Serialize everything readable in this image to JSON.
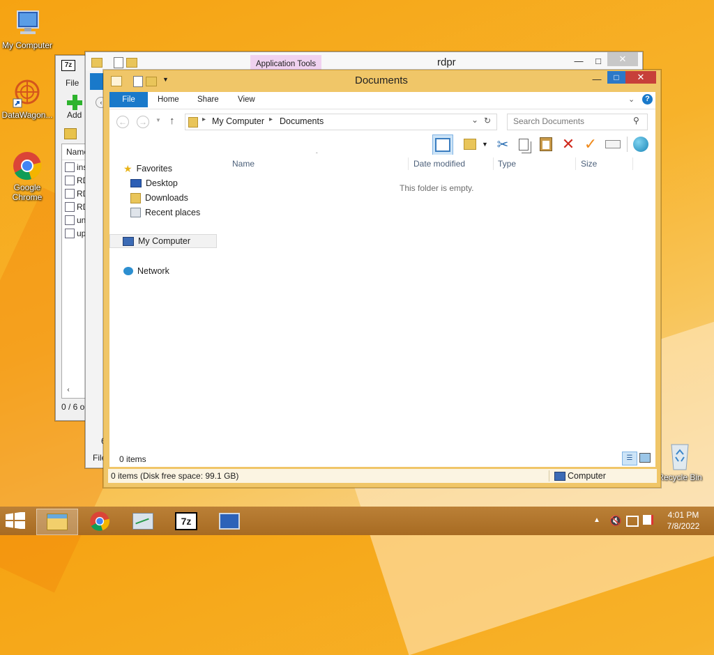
{
  "desktop": {
    "icons": [
      {
        "label": "My Computer"
      },
      {
        "label": "DataWagon..."
      },
      {
        "label": "Google Chrome"
      },
      {
        "label": "Recycle Bin"
      }
    ]
  },
  "win_7z": {
    "app_icon": "7z",
    "menu_file": "File",
    "add_label": "Add",
    "col_name": "Name",
    "rows": [
      "ins",
      "RD",
      "RD",
      "RD",
      "un",
      "up"
    ],
    "status": "0 / 6 o"
  },
  "win_rdpr": {
    "context_tab": "Application Tools",
    "title": "rdpr",
    "status_prefix": "6",
    "file_label": "File"
  },
  "explorer": {
    "title": "Documents",
    "tabs": {
      "file": "File",
      "home": "Home",
      "share": "Share",
      "view": "View"
    },
    "address": {
      "seg1": "My Computer",
      "seg2": "Documents"
    },
    "search_placeholder": "Search Documents",
    "nav": {
      "favorites": "Favorites",
      "desktop": "Desktop",
      "downloads": "Downloads",
      "recent": "Recent places",
      "computer": "My Computer",
      "network": "Network"
    },
    "columns": {
      "name": "Name",
      "date": "Date modified",
      "type": "Type",
      "size": "Size"
    },
    "empty_message": "This folder is empty.",
    "item_count": "0 items",
    "status_left": "0 items (Disk free space: 99.1 GB)",
    "status_right": "Computer"
  },
  "taskbar": {
    "time": "4:01 PM",
    "date": "7/8/2022",
    "seven_zip_label": "7z"
  },
  "colors": {
    "accent_blue": "#1979ca",
    "explorer_frame": "#f0c668",
    "close_red": "#c7403a"
  }
}
